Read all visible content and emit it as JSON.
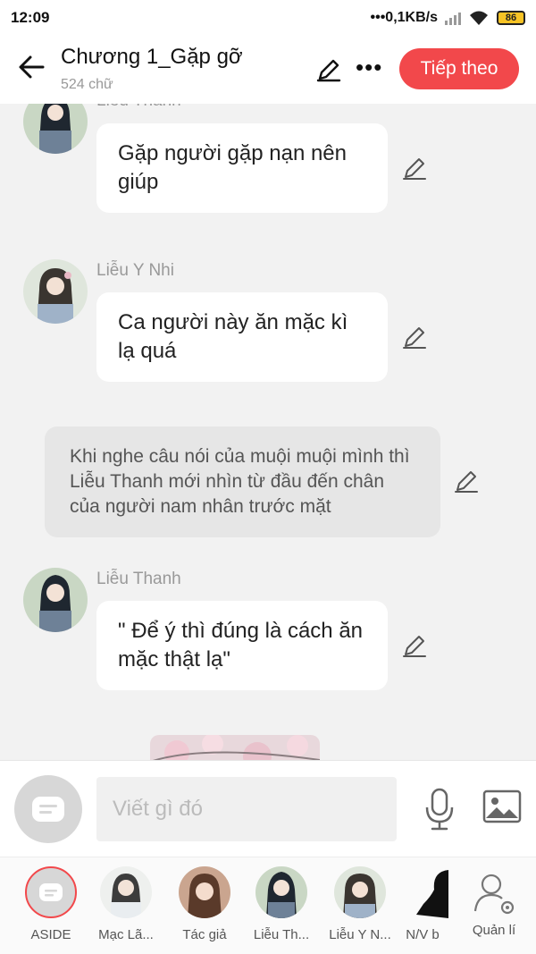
{
  "status": {
    "time": "12:09",
    "network_speed": "0,1KB/s",
    "battery": "86"
  },
  "header": {
    "title": "Chương 1_Gặp gỡ",
    "subtitle": "524 chữ",
    "next_label": "Tiếp theo"
  },
  "messages": [
    {
      "speaker": "Liễu Thanh",
      "text": "Gặp người gặp nạn nên giúp"
    },
    {
      "speaker": "Liễu Y Nhi",
      "text": "Ca người này ăn mặc kì lạ quá"
    },
    {
      "narration": "Khi nghe câu nói của muội muội mình thì Liễu Thanh mới nhìn từ đầu đến chân của người nam nhân trước mặt"
    },
    {
      "speaker": "Liễu Thanh",
      "text": "\" Để ý thì đúng là cách ăn mặc thật lạ\""
    }
  ],
  "composer": {
    "placeholder": "Viết gì đó"
  },
  "characters": [
    {
      "label": "ASIDE"
    },
    {
      "label": "Mạc Lã..."
    },
    {
      "label": "Tác giả"
    },
    {
      "label": "Liễu Th..."
    },
    {
      "label": "Liễu Y N..."
    },
    {
      "label": "N/V b"
    },
    {
      "label": "Quản lí"
    }
  ],
  "colors": {
    "accent": "#f2484b",
    "background": "#f2f2f2",
    "bubble": "#ffffff",
    "narration": "#e6e6e6"
  }
}
